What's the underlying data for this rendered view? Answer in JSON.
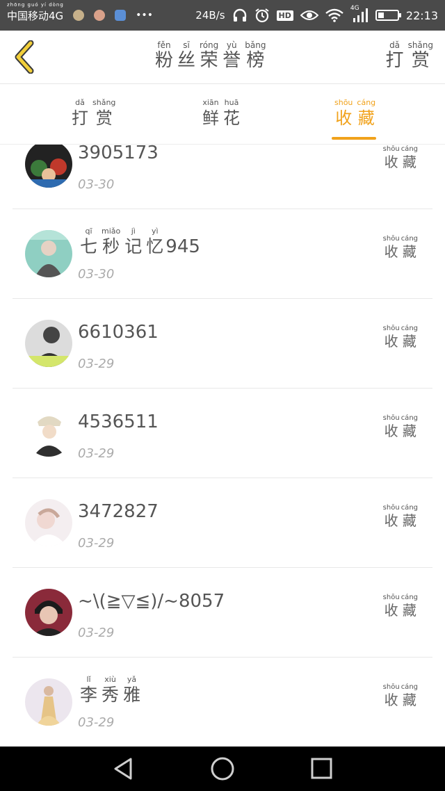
{
  "status_bar": {
    "carrier": "中国移动4G",
    "carrier_pinyin": "zhōng guó yí dòng",
    "net_speed": "24B/s",
    "signal_label": "4G",
    "hd_label": "HD",
    "battery_level": 0.3,
    "time": "22:13",
    "icons": [
      "app-icon",
      "app-icon-2",
      "location-icon",
      "more-dots-icon",
      "headphones-icon",
      "alarm-icon",
      "eye-icon",
      "wifi-icon",
      "signal-icon",
      "battery-icon"
    ]
  },
  "header": {
    "title_chars": [
      {
        "h": "粉",
        "p": "fěn"
      },
      {
        "h": "丝",
        "p": "sī"
      },
      {
        "h": "荣",
        "p": "róng"
      },
      {
        "h": "誉",
        "p": "yù"
      },
      {
        "h": "榜",
        "p": "bǎng"
      }
    ],
    "reward_chars": [
      {
        "h": "打",
        "p": "dǎ"
      },
      {
        "h": "赏",
        "p": "shǎng"
      }
    ],
    "back_icon": "back-arrow-icon",
    "accent": "#f1a21b"
  },
  "tabs": [
    {
      "chars": [
        {
          "h": "打",
          "p": "dǎ"
        },
        {
          "h": "赏",
          "p": "shǎng"
        }
      ],
      "active": false
    },
    {
      "chars": [
        {
          "h": "鲜",
          "p": "xiān"
        },
        {
          "h": "花",
          "p": "huā"
        }
      ],
      "active": false
    },
    {
      "chars": [
        {
          "h": "收",
          "p": "shōu"
        },
        {
          "h": "藏",
          "p": "cáng"
        }
      ],
      "active": true
    }
  ],
  "action_chars": [
    {
      "h": "收",
      "p": "shōu"
    },
    {
      "h": "藏",
      "p": "cáng"
    }
  ],
  "rows": [
    {
      "name": "3905173",
      "date": "03-30"
    },
    {
      "name": "七秒记忆945",
      "date": "03-30",
      "ruby": [
        {
          "h": "七",
          "p": "qī"
        },
        {
          "h": "秒",
          "p": "miǎo"
        },
        {
          "h": "记",
          "p": "jì"
        },
        {
          "h": "忆",
          "p": "yì"
        }
      ],
      "suffix": "945"
    },
    {
      "name": "6610361",
      "date": "03-29"
    },
    {
      "name": "4536511",
      "date": "03-29"
    },
    {
      "name": "3472827",
      "date": "03-29"
    },
    {
      "name": "~\\(≧▽≦)/~8057",
      "date": "03-29"
    },
    {
      "name": "李秀雅",
      "date": "03-29",
      "ruby": [
        {
          "h": "李",
          "p": "lǐ"
        },
        {
          "h": "秀",
          "p": "xiù"
        },
        {
          "h": "雅",
          "p": "yǎ"
        }
      ],
      "suffix": ""
    }
  ],
  "nav_icons": [
    "back-triangle-icon",
    "home-circle-icon",
    "recent-square-icon"
  ]
}
